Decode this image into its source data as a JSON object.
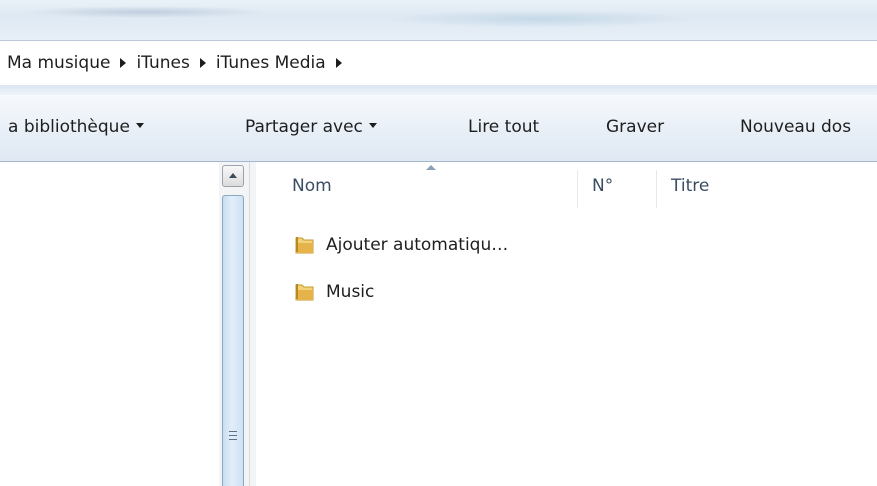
{
  "breadcrumb": {
    "items": [
      "Ma musique",
      "iTunes",
      "iTunes Media"
    ]
  },
  "toolbar": {
    "library": "a bibliothèque",
    "share": "Partager avec",
    "play_all": "Lire tout",
    "burn": "Graver",
    "new_folder": "Nouveau dos"
  },
  "columns": {
    "name": "Nom",
    "number": "N°",
    "title": "Titre"
  },
  "files": [
    {
      "name": "Ajouter automatiqu…",
      "icon": "folder-icon"
    },
    {
      "name": "Music",
      "icon": "folder-icon"
    }
  ],
  "colors": {
    "folder": "#e6b34a",
    "toolbar_bg": "#e8eff7",
    "column_header_text": "#3b4d62"
  }
}
